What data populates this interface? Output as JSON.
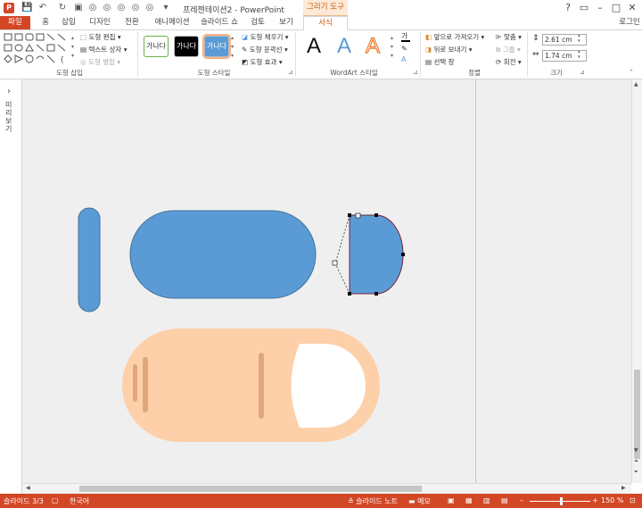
{
  "window": {
    "title": "프레젠테이션2 - PowerPoint",
    "context_tab": "그리기 도구",
    "signin": "로그인"
  },
  "tabs": [
    "파일",
    "홈",
    "삽입",
    "디자인",
    "전환",
    "애니메이션",
    "슬라이드 쇼",
    "검토",
    "보기",
    "서식"
  ],
  "ribbon": {
    "insert_shapes": {
      "edit_shape": "도형 편집",
      "text_box": "텍스트 상자",
      "merge_shapes": "도형 병합",
      "label": "도형 삽입"
    },
    "shape_styles": {
      "style_text": "가나다",
      "fill": "도형 채우기",
      "outline": "도형 윤곽선",
      "effects": "도형 효과",
      "label": "도형 스타일"
    },
    "wordart": {
      "sample": "A",
      "label": "WordArt 스타일",
      "text_fill_glyph": "가"
    },
    "arrange": {
      "bring_forward": "앞으로 가져오기",
      "send_backward": "뒤로 보내기",
      "selection_pane": "선택 창",
      "align": "맞춤",
      "group": "그룹",
      "rotate": "회전",
      "label": "정렬"
    },
    "size": {
      "height": "2.61 cm",
      "width": "1.74 cm",
      "label": "크기"
    }
  },
  "left_pane": {
    "label": "미리 보기",
    "expand_glyph": "›"
  },
  "status": {
    "slide": "슬라이드 3/3",
    "language": "한국어",
    "notes": "슬라이드 노트",
    "comments": "메모",
    "zoom": "150 %"
  },
  "colors": {
    "accent": "#d24726",
    "shape_blue": "#5b9bd5",
    "shape_outline": "#41719c",
    "peach": "#fdd0a9",
    "peach_line": "#e0a77d",
    "canvas": "#efefef"
  }
}
